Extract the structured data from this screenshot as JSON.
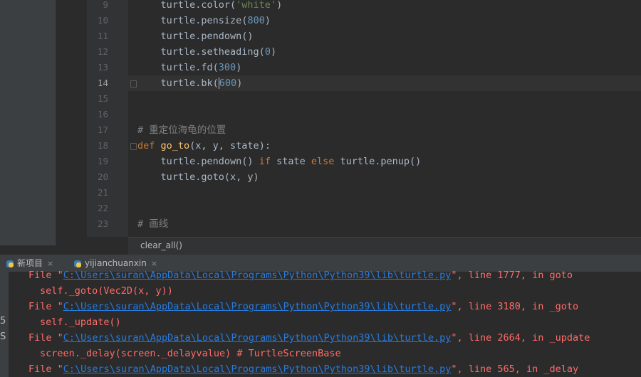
{
  "editor": {
    "lines": [
      {
        "num": "9",
        "tokens": [
          {
            "t": "    turtle.color(",
            "c": ""
          },
          {
            "t": "'white'",
            "c": "str"
          },
          {
            "t": ")",
            "c": ""
          }
        ]
      },
      {
        "num": "10",
        "tokens": [
          {
            "t": "    turtle.pensize(",
            "c": ""
          },
          {
            "t": "800",
            "c": "num"
          },
          {
            "t": ")",
            "c": ""
          }
        ]
      },
      {
        "num": "11",
        "tokens": [
          {
            "t": "    turtle.pendown()",
            "c": ""
          }
        ]
      },
      {
        "num": "12",
        "tokens": [
          {
            "t": "    turtle.setheading(",
            "c": ""
          },
          {
            "t": "0",
            "c": "num"
          },
          {
            "t": ")",
            "c": ""
          }
        ]
      },
      {
        "num": "13",
        "tokens": [
          {
            "t": "    turtle.fd(",
            "c": ""
          },
          {
            "t": "300",
            "c": "num"
          },
          {
            "t": ")",
            "c": ""
          }
        ]
      },
      {
        "num": "14",
        "tokens": [
          {
            "t": "    turtle.bk(",
            "c": ""
          },
          {
            "t": "600",
            "c": "num"
          },
          {
            "t": ")",
            "c": ""
          }
        ],
        "current": true
      },
      {
        "num": "15",
        "tokens": []
      },
      {
        "num": "16",
        "tokens": []
      },
      {
        "num": "17",
        "tokens": [
          {
            "t": "# 重定位海龟的位置",
            "c": "cmt"
          }
        ]
      },
      {
        "num": "18",
        "tokens": [
          {
            "t": "def ",
            "c": "kw"
          },
          {
            "t": "go_to",
            "c": "fn"
          },
          {
            "t": "(x, y, state):",
            "c": ""
          }
        ]
      },
      {
        "num": "19",
        "tokens": [
          {
            "t": "    turtle.pendown() ",
            "c": ""
          },
          {
            "t": "if ",
            "c": "kw"
          },
          {
            "t": "state ",
            "c": ""
          },
          {
            "t": "else ",
            "c": "kw"
          },
          {
            "t": "turtle.penup()",
            "c": ""
          }
        ]
      },
      {
        "num": "20",
        "tokens": [
          {
            "t": "    turtle.goto(x, y)",
            "c": ""
          }
        ]
      },
      {
        "num": "21",
        "tokens": []
      },
      {
        "num": "22",
        "tokens": []
      },
      {
        "num": "23",
        "tokens": [
          {
            "t": "# 画线",
            "c": "cmt"
          }
        ]
      }
    ]
  },
  "breadcrumb": "clear_all()",
  "run_tabs": [
    {
      "label": "新项目",
      "icon": "python-icon"
    },
    {
      "label": "yijianchuanxin",
      "icon": "python-icon"
    }
  ],
  "console": {
    "lines": [
      {
        "kind": "file",
        "prefix": "File \"",
        "path": "C:\\Users\\suran\\AppData\\Local\\Programs\\Python\\Python39\\lib\\turtle.py",
        "suffix": "\", line 1777, in goto"
      },
      {
        "kind": "code",
        "text": "self._goto(Vec2D(x, y))"
      },
      {
        "kind": "file",
        "prefix": "File \"",
        "path": "C:\\Users\\suran\\AppData\\Local\\Programs\\Python\\Python39\\lib\\turtle.py",
        "suffix": "\", line 3180, in _goto"
      },
      {
        "kind": "code",
        "text": "self._update()"
      },
      {
        "kind": "file",
        "prefix": "File \"",
        "path": "C:\\Users\\suran\\AppData\\Local\\Programs\\Python\\Python39\\lib\\turtle.py",
        "suffix": "\", line 2664, in _update"
      },
      {
        "kind": "code",
        "text": "screen._delay(screen._delayvalue) # TurtleScreenBase"
      },
      {
        "kind": "file",
        "prefix": "File \"",
        "path": "C:\\Users\\suran\\AppData\\Local\\Programs\\Python\\Python39\\lib\\turtle.py",
        "suffix": "\", line 565, in _delay"
      }
    ]
  },
  "side_glyphs": [
    "5",
    "S"
  ],
  "colors": {
    "error": "#ff6b68",
    "link": "#287bde",
    "background": "#2b2b2b"
  }
}
